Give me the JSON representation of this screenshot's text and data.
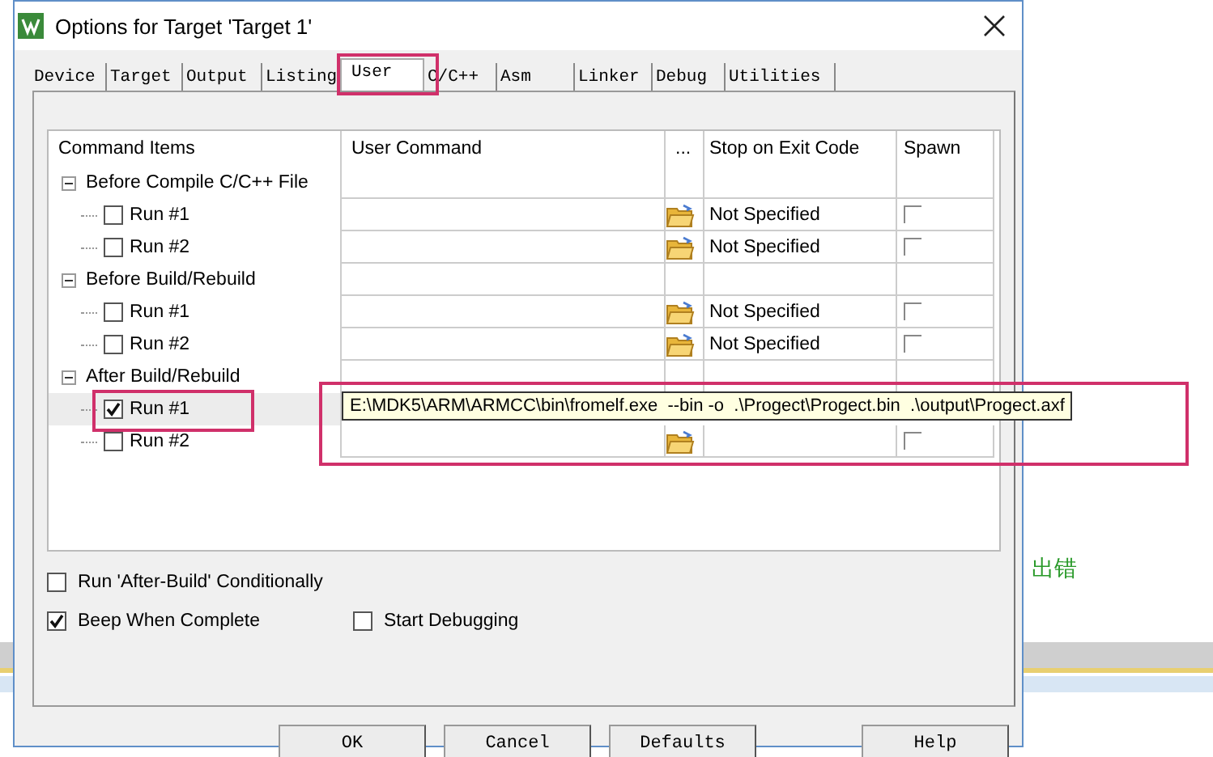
{
  "window": {
    "title": "Options for Target 'Target 1'"
  },
  "tabs": [
    {
      "label": "Device",
      "selected": false
    },
    {
      "label": "Target",
      "selected": false
    },
    {
      "label": "Output",
      "selected": false
    },
    {
      "label": "Listing",
      "selected": false
    },
    {
      "label": "User",
      "selected": true
    },
    {
      "label": "C/C++",
      "selected": false
    },
    {
      "label": "Asm",
      "selected": false
    },
    {
      "label": "Linker",
      "selected": false
    },
    {
      "label": "Debug",
      "selected": false
    },
    {
      "label": "Utilities",
      "selected": false
    }
  ],
  "table": {
    "columns": [
      "Command Items",
      "User Command",
      "...",
      "Stop on Exit Code",
      "Spawn"
    ],
    "groups": [
      {
        "label": "Before Compile C/C++ File",
        "expanded": true,
        "children": [
          {
            "label": "Run #1",
            "checked": false,
            "selected": false,
            "stop_code": "Not Specified",
            "spawn": false
          },
          {
            "label": "Run #2",
            "checked": false,
            "selected": false,
            "stop_code": "Not Specified",
            "spawn": false
          }
        ]
      },
      {
        "label": "Before Build/Rebuild",
        "expanded": true,
        "children": [
          {
            "label": "Run #1",
            "checked": false,
            "selected": false,
            "stop_code": "Not Specified",
            "spawn": false
          },
          {
            "label": "Run #2",
            "checked": false,
            "selected": false,
            "stop_code": "Not Specified",
            "spawn": false
          }
        ]
      },
      {
        "label": "After Build/Rebuild",
        "expanded": true,
        "children": [
          {
            "label": "Run #1",
            "checked": true,
            "selected": true
          },
          {
            "label": "Run #2",
            "checked": false,
            "selected": false,
            "spawn": false
          }
        ]
      }
    ]
  },
  "tooltip": {
    "text": "E:\\MDK5\\ARM\\ARMCC\\bin\\fromelf.exe  --bin -o  .\\Progect\\Progect.bin  .\\output\\Progect.axf"
  },
  "options": [
    {
      "label": "Run 'After-Build' Conditionally",
      "checked": false
    },
    {
      "label": "Beep When Complete",
      "checked": true
    },
    {
      "label": "Start Debugging",
      "checked": false
    }
  ],
  "buttons": [
    "OK",
    "Cancel",
    "Defaults",
    "Help"
  ],
  "background_text": "出错"
}
